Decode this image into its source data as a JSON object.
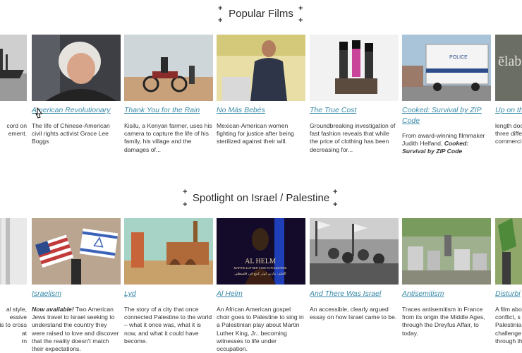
{
  "sections": [
    {
      "heading": "Popular Films",
      "cards": [
        {
          "title": "",
          "desc": "cord on\nement."
        },
        {
          "title": "American Revolutionary",
          "desc": "The life of Chinese-American civil rights activist Grace Lee Boggs"
        },
        {
          "title": "Thank You for the Rain",
          "desc": "Kisilu, a Kenyan farmer, uses his camera to capture the life of his family, his village and the damages of..."
        },
        {
          "title": "No Más Bebés",
          "desc": "Mexican-American women fighting for justice after being sterilized against their will."
        },
        {
          "title": "The True Cost",
          "desc": "Groundbreaking investigation of fast fashion reveals that while the price of clothing has been decreasing for..."
        },
        {
          "title": "Cooked: Survival by ZIP Code",
          "desc_plain": "From award-winning filmmaker Judith Helfand, ",
          "desc_strong": "Cooked: Survival by ZIP Code"
        },
        {
          "title": "Up on the",
          "desc": "length doc\nthree diffe\ncommerci"
        }
      ]
    },
    {
      "heading": "Spotlight on Israel / Palestine",
      "cards": [
        {
          "title": "",
          "desc": "al style,\nessive\nis to cross\nat\nrn"
        },
        {
          "title": "Israelism",
          "desc_strong": "Now available!",
          "desc_plain": " Two American Jews travel to Israel seeking to understand the country they were raised to love and discover that the reality doesn't match their expectations."
        },
        {
          "title": "Lyd",
          "desc": "The story of a city that once connected Palestine to the world – what it once was, what it is now, and what it could have become."
        },
        {
          "title": "Al Helm",
          "desc": "An African American gospel choir goes to Palestine to sing in a Palestinian play about Martin Luther King, Jr.. becoming witnesses to life under occupation."
        },
        {
          "title": "And There Was Israel",
          "desc": "An accessible, clearly argued essay on how Israel came to be."
        },
        {
          "title": "Antisemitism",
          "desc": "Traces antisemitism in France from its origin the Middle Ages, through the Dreyfus Affair, to today."
        },
        {
          "title": "Disturbi",
          "desc": "A film abo\nconflict, s\nPalestinia\nchallenge\nthrough th"
        }
      ]
    }
  ],
  "poster_texts": {
    "police": "POLICE",
    "al_helm_title": "AL HELM",
    "al_helm_sub": "MARTIN LUTHER KING IN PALESTINE",
    "al_helm_arabic": "الحلم: مارتن لوثر كينغ في فلسطين",
    "up_on": "ēlab"
  },
  "colors": {
    "link": "#3a8aa8",
    "text": "#333333",
    "heading": "#2b2b2b"
  }
}
